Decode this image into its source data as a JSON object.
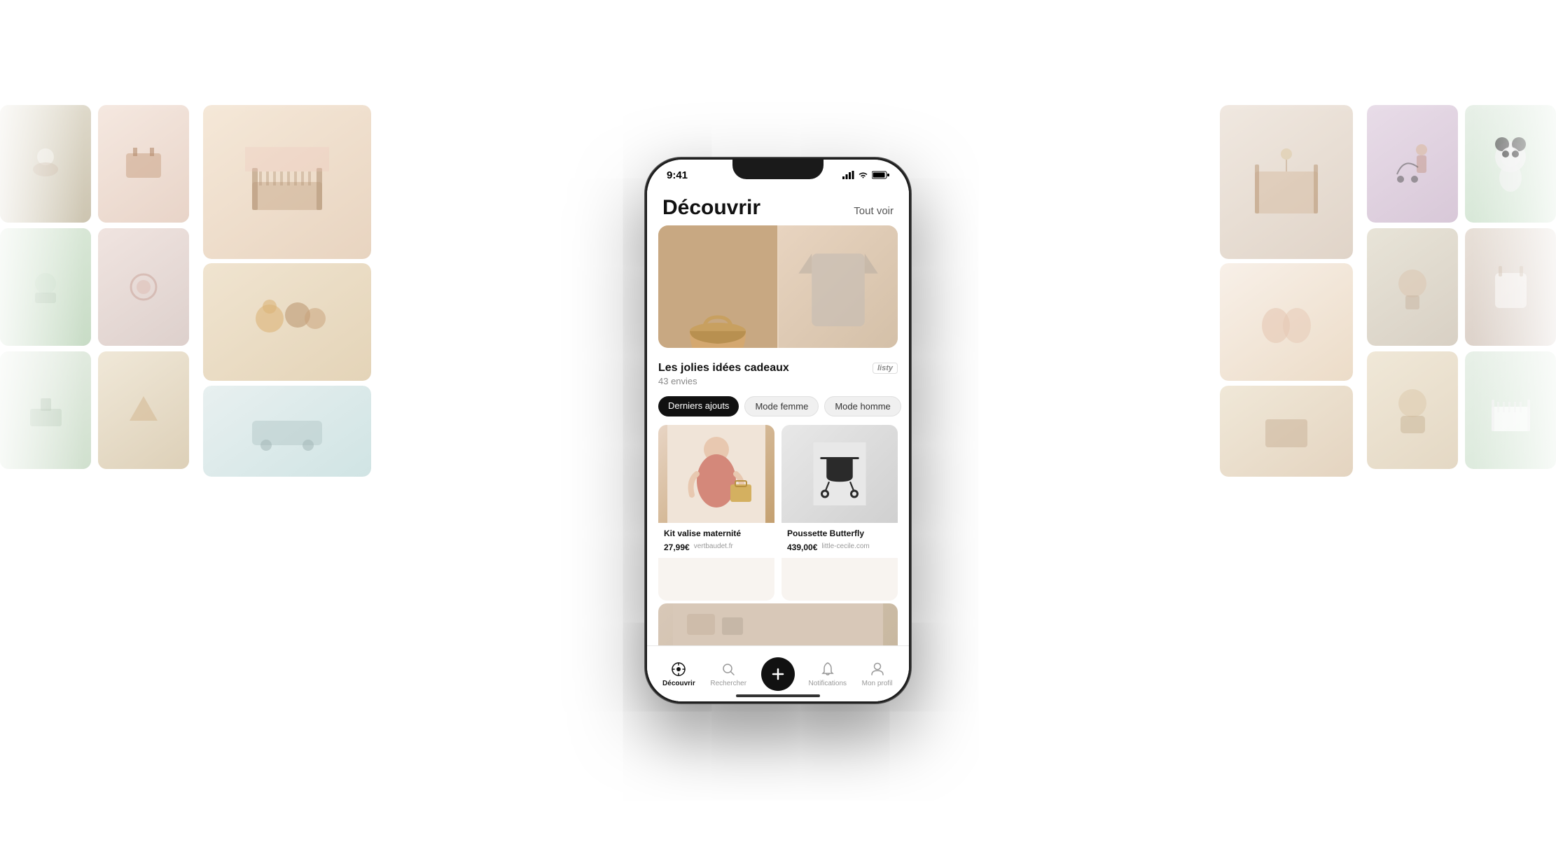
{
  "app": {
    "name": "Listy",
    "status_time": "9:41"
  },
  "header": {
    "title": "Découvrir",
    "tout_voir": "Tout voir"
  },
  "featured": {
    "title": "Les jolies idées cadeaux",
    "subtitle": "43 envies",
    "badge": "listy"
  },
  "filters": [
    {
      "label": "Derniers ajouts",
      "active": true
    },
    {
      "label": "Mode femme",
      "active": false
    },
    {
      "label": "Mode homme",
      "active": false
    }
  ],
  "products": [
    {
      "name": "Kit valise maternité",
      "price": "27,99€",
      "source": "vertbaudet.fr"
    },
    {
      "name": "Poussette Butterfly",
      "price": "439,00€",
      "source": "little-cecile.com"
    }
  ],
  "nav": {
    "items": [
      {
        "label": "Découvrir",
        "active": true
      },
      {
        "label": "Rechercher",
        "active": false
      },
      {
        "label": "+",
        "active": false,
        "is_add": true
      },
      {
        "label": "Notifications",
        "active": false
      },
      {
        "label": "Mon profil",
        "active": false
      }
    ]
  },
  "background": {
    "images_description": "Grid of baby/children product photos arranged behind phone"
  }
}
